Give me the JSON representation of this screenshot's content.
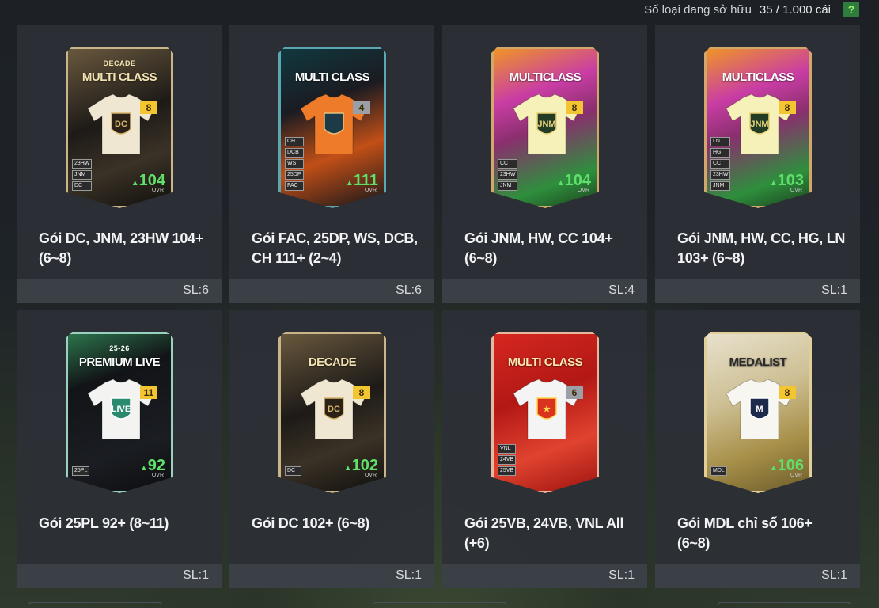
{
  "header": {
    "owned_label": "Số loại đang sở hữu",
    "owned_count": "35 / 1.000 cái",
    "help_label": "?"
  },
  "ovr_label": "OVR",
  "packs": [
    {
      "title": "Gói DC, JNM, 23HW 104+ (6~8)",
      "qty": "SL:6",
      "brand_top": "DECADE",
      "brand": "MULTI CLASS",
      "badge": "8",
      "ovr": "104",
      "crest": "DC",
      "tags": [
        "23HW",
        "JNM",
        "DC"
      ],
      "theme": "decade"
    },
    {
      "title": "Gói FAC, 25DP, WS, DCB, CH 111+ (2~4)",
      "qty": "SL:6",
      "brand_top": "",
      "brand": "MULTI CLASS",
      "badge": "4",
      "ovr": "111",
      "crest": "",
      "tags": [
        "CH",
        "DCB",
        "WS",
        "25DP",
        "FAC"
      ],
      "theme": "orange"
    },
    {
      "title": "Gói JNM, HW, CC 104+ (6~8)",
      "qty": "SL:4",
      "brand_top": "",
      "brand": "MULTICLASS",
      "badge": "8",
      "ovr": "104",
      "crest": "JNM",
      "tags": [
        "CC",
        "23HW",
        "JNM"
      ],
      "theme": "multi"
    },
    {
      "title": "Gói JNM, HW, CC, HG, LN 103+ (6~8)",
      "qty": "SL:1",
      "brand_top": "",
      "brand": "MULTICLASS",
      "badge": "8",
      "ovr": "103",
      "crest": "JNM",
      "tags": [
        "LN",
        "HG",
        "CC",
        "23HW",
        "JNM"
      ],
      "theme": "multi"
    },
    {
      "title": "Gói 25PL 92+ (8~11)",
      "qty": "SL:1",
      "brand_top": "25-26",
      "brand": "PREMIUM LIVE",
      "badge": "11",
      "ovr": "92",
      "crest": "LIVE",
      "tags": [
        "25PL"
      ],
      "theme": "live"
    },
    {
      "title": "Gói DC 102+ (6~8)",
      "qty": "SL:1",
      "brand_top": "",
      "brand": "DECADE",
      "badge": "8",
      "ovr": "102",
      "crest": "DC",
      "tags": [
        "DC"
      ],
      "theme": "decade"
    },
    {
      "title": "Gói 25VB, 24VB, VNL All (+6)",
      "qty": "SL:1",
      "brand_top": "",
      "brand": "MULTI CLASS",
      "badge": "6",
      "ovr": "",
      "crest": "★",
      "tags": [
        "VNL",
        "24VB",
        "25VB"
      ],
      "theme": "red"
    },
    {
      "title": "Gói MDL chỉ số 106+ (6~8)",
      "qty": "SL:1",
      "brand_top": "",
      "brand": "MEDALIST",
      "badge": "8",
      "ovr": "106",
      "crest": "M",
      "tags": [
        "MDL"
      ],
      "theme": "medalist"
    }
  ],
  "colors": {
    "ovr_green": "#5fe06a",
    "badge_gold": "#f3c531",
    "badge_gray": "#9aa0a6"
  }
}
